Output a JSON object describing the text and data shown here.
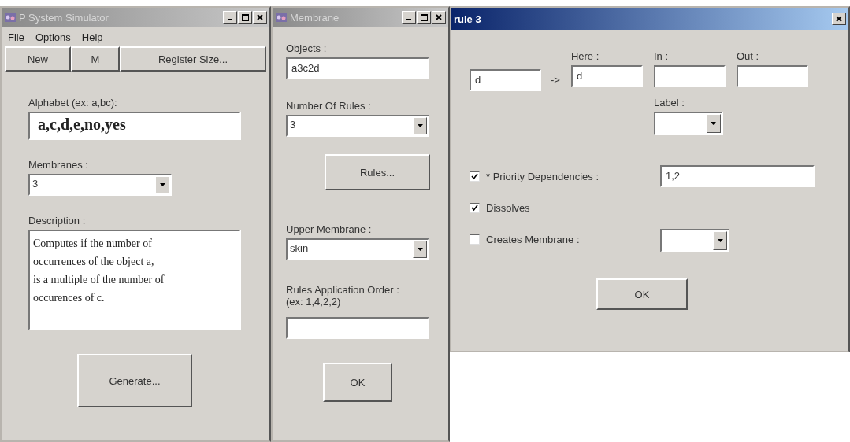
{
  "simulator": {
    "title": "P System Simulator",
    "active": false,
    "menu": [
      "File",
      "Options",
      "Help"
    ],
    "toolbar": [
      "New",
      "M",
      "Register Size..."
    ],
    "alphabet": {
      "label": "Alphabet (ex: a,bc):",
      "value": "a,c,d,e,no,yes"
    },
    "membranes": {
      "label": "Membranes :",
      "value": "3"
    },
    "description": {
      "label": "Description :",
      "lines": [
        "Computes if the number of",
        "occurrences of the object a,",
        "is a multiple of the number of",
        "occurences of c."
      ]
    },
    "generate_button": "Generate..."
  },
  "membrane": {
    "title": "Membrane",
    "active": false,
    "objects": {
      "label": "Objects :",
      "value": "a3c2d"
    },
    "rules_count": {
      "label": "Number Of Rules :",
      "value": "3"
    },
    "rules_button": "Rules...",
    "upper_membrane": {
      "label": "Upper Membrane :",
      "value": "skin"
    },
    "application_order": {
      "label": "Rules Application Order :",
      "hint": "(ex: 1,4,2,2)"
    },
    "ok_button": "OK"
  },
  "rule": {
    "title": "rule 3",
    "active": true,
    "left": {
      "value": "d"
    },
    "arrow": "->",
    "targets": [
      {
        "label": "Here :",
        "value": "d"
      },
      {
        "label": "In :"
      },
      {
        "label": "Out :"
      }
    ],
    "label_select": {
      "label": "Label :"
    },
    "priority": {
      "label": "* Priority Dependencies :",
      "checked": true,
      "value": "1,2"
    },
    "dissolves": {
      "label": "Dissolves",
      "checked": true
    },
    "creates": {
      "label": "Creates Membrane :",
      "checked": false
    },
    "ok_button": "OK"
  }
}
